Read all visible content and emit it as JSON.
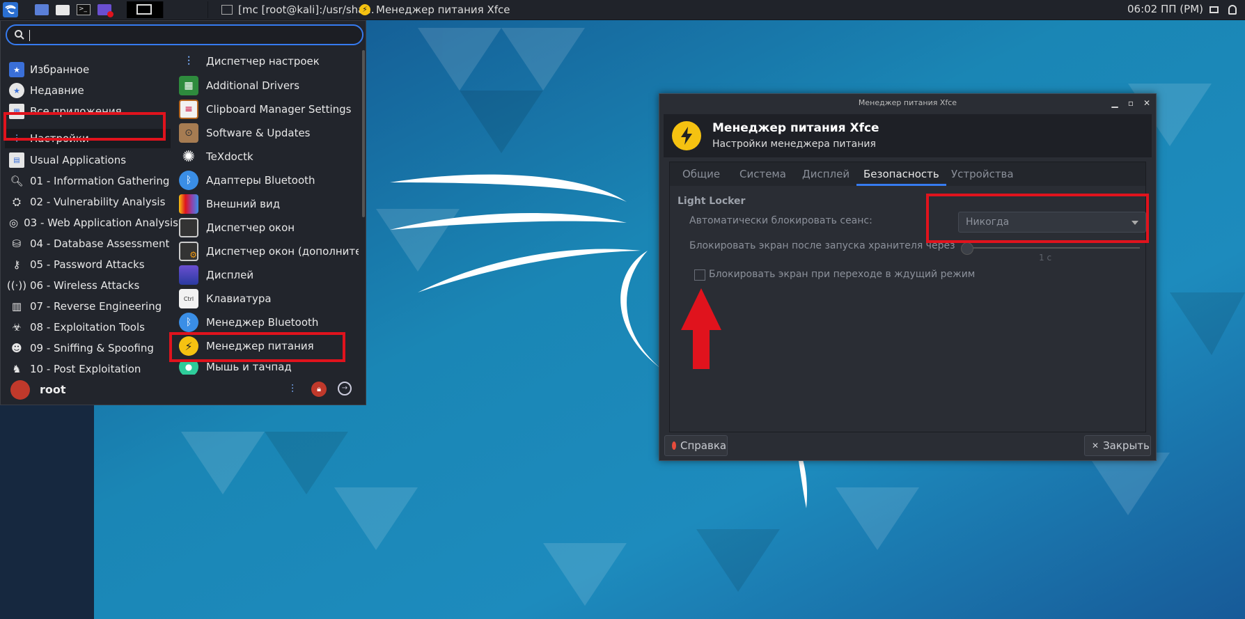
{
  "panel": {
    "task_terminal": "[mc [root@kali]:/usr/sha...",
    "task_power": "Менеджер питания Xfce",
    "clock": "06:02 ПП (PM)"
  },
  "menu": {
    "categories": [
      {
        "label": "Избранное",
        "icon": "star-folder-icon"
      },
      {
        "label": "Недавние",
        "icon": "recent-icon"
      },
      {
        "label": "Все приложения",
        "icon": "all-apps-icon"
      },
      {
        "label": "Настройки",
        "icon": "settings-icon"
      },
      {
        "label": "Usual Applications",
        "icon": "usual-apps-icon"
      },
      {
        "label": "01 - Information Gathering",
        "icon": "magnifier-icon"
      },
      {
        "label": "02 - Vulnerability Analysis",
        "icon": "vuln-icon"
      },
      {
        "label": "03 - Web Application Analysis",
        "icon": "globe-icon"
      },
      {
        "label": "04 - Database Assessment",
        "icon": "database-icon"
      },
      {
        "label": "05 - Password Attacks",
        "icon": "key-icon"
      },
      {
        "label": "06 - Wireless Attacks",
        "icon": "wireless-icon"
      },
      {
        "label": "07 - Reverse Engineering",
        "icon": "chip-icon"
      },
      {
        "label": "08 - Exploitation Tools",
        "icon": "exploit-icon"
      },
      {
        "label": "09 - Sniffing & Spoofing",
        "icon": "spy-icon"
      },
      {
        "label": "10 - Post Exploitation",
        "icon": "post-icon"
      }
    ],
    "apps": [
      {
        "label": "Диспетчер настроек",
        "icon": "settings-manager-icon"
      },
      {
        "label": "Additional Drivers",
        "icon": "drivers-icon"
      },
      {
        "label": "Clipboard Manager Settings",
        "icon": "clipboard-icon"
      },
      {
        "label": "Software & Updates",
        "icon": "software-icon"
      },
      {
        "label": "TeXdoctk",
        "icon": "texdoc-icon"
      },
      {
        "label": "Адаптеры Bluetooth",
        "icon": "bluetooth-icon"
      },
      {
        "label": "Внешний вид",
        "icon": "appearance-icon"
      },
      {
        "label": "Диспетчер окон",
        "icon": "window-manager-icon"
      },
      {
        "label": "Диспетчер окон (дополнитель...",
        "icon": "window-tweaks-icon"
      },
      {
        "label": "Дисплей",
        "icon": "display-icon"
      },
      {
        "label": "Клавиатура",
        "icon": "keyboard-icon"
      },
      {
        "label": "Менеджер Bluetooth",
        "icon": "bluetooth-manager-icon"
      },
      {
        "label": "Менеджер питания",
        "icon": "power-manager-icon"
      },
      {
        "label": "Мышь и тачпад",
        "icon": "mouse-icon"
      }
    ],
    "keyboard_icon_text": "Ctrl",
    "user": "root"
  },
  "dialog": {
    "window_title": "Менеджер питания Xfce",
    "header_title": "Менеджер питания Xfce",
    "header_subtitle": "Настройки менеджера питания",
    "tabs": [
      "Общие",
      "Система",
      "Дисплей",
      "Безопасность",
      "Устройства"
    ],
    "active_tab": "Безопасность",
    "section": "Light Locker",
    "auto_lock_label": "Автоматически блокировать сеанс:",
    "auto_lock_value": "Никогда",
    "lock_after_label": "Блокировать экран после запуска хранителя через",
    "lock_after_value": "1 с",
    "lock_on_sleep_label": "Блокировать экран при переходе в ждущий режим",
    "lock_on_sleep_checked": false,
    "help_button": "Справка",
    "close_button": "Закрыть"
  },
  "colors": {
    "accent": "#367bf0",
    "highlight": "#e0131d",
    "power_yellow": "#f5c211"
  }
}
